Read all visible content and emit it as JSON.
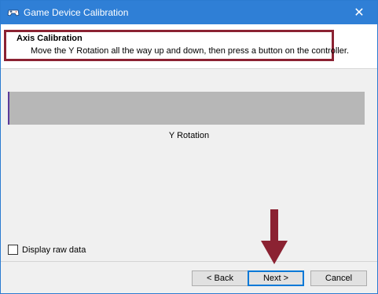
{
  "window": {
    "title": "Game Device Calibration"
  },
  "header": {
    "title": "Axis Calibration",
    "description": "Move the Y Rotation all the way up and down, then press a button on the controller."
  },
  "main": {
    "axis_label": "Y Rotation",
    "axis_position": 0
  },
  "options": {
    "display_raw_data_label": "Display raw data",
    "display_raw_data_checked": false
  },
  "buttons": {
    "back": "< Back",
    "next": "Next >",
    "cancel": "Cancel"
  },
  "icons": {
    "app": "gamepad-icon",
    "close": "close-icon",
    "annotation": "arrow-down-icon"
  },
  "colors": {
    "titlebar": "#2f7fd6",
    "highlight": "#8b2232",
    "bar": "#b7b7b7"
  }
}
